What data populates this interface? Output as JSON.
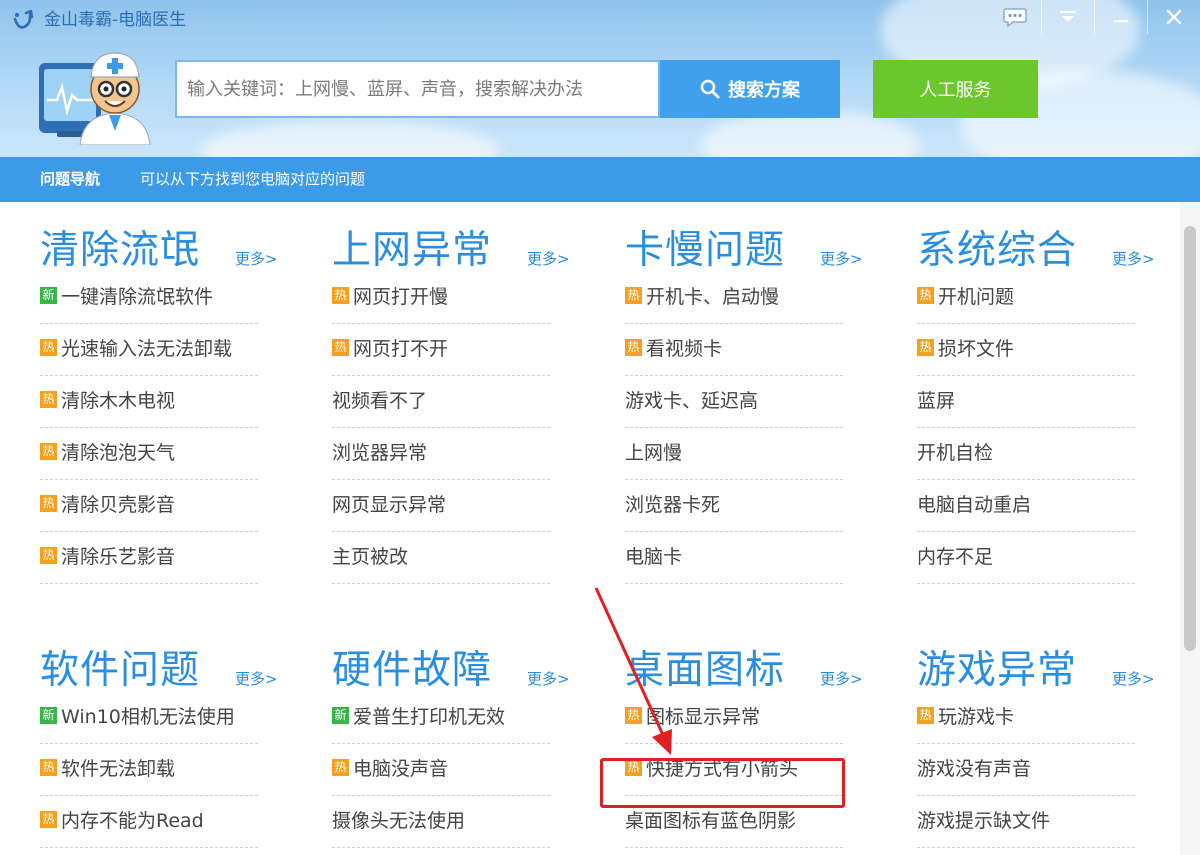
{
  "app": {
    "title": "金山毒霸-电脑医生"
  },
  "window": {
    "controls": [
      "chat-icon",
      "menu-icon",
      "minimize-icon",
      "close-icon"
    ]
  },
  "search": {
    "placeholder": "输入关键词：上网慢、蓝屏、声音，搜索解决办法",
    "button_label": "搜索方案"
  },
  "service": {
    "label": "人工服务"
  },
  "nav": {
    "title": "问题导航",
    "hint": "可以从下方找到您电脑对应的问题"
  },
  "badges": {
    "new": "新",
    "hot": "热"
  },
  "colors": {
    "accent_blue": "#2a8ee0",
    "nav_blue": "#3c9be8",
    "service_green": "#6cc72c",
    "hot_orange": "#f5a021",
    "new_green": "#3ab54a",
    "annotation_red": "#e02020"
  },
  "sections": [
    {
      "title": "清除流氓",
      "more": "更多>",
      "items": [
        {
          "badge": "new",
          "text": "一键清除流氓软件"
        },
        {
          "badge": "hot",
          "text": "光速输入法无法卸载"
        },
        {
          "badge": "hot",
          "text": "清除木木电视"
        },
        {
          "badge": "hot",
          "text": "清除泡泡天气"
        },
        {
          "badge": "hot",
          "text": "清除贝壳影音"
        },
        {
          "badge": "hot",
          "text": "清除乐艺影音"
        }
      ]
    },
    {
      "title": "上网异常",
      "more": "更多>",
      "items": [
        {
          "badge": "hot",
          "text": "网页打开慢"
        },
        {
          "badge": "hot",
          "text": "网页打不开"
        },
        {
          "badge": "",
          "text": "视频看不了"
        },
        {
          "badge": "",
          "text": "浏览器异常"
        },
        {
          "badge": "",
          "text": "网页显示异常"
        },
        {
          "badge": "",
          "text": "主页被改"
        }
      ]
    },
    {
      "title": "卡慢问题",
      "more": "更多>",
      "items": [
        {
          "badge": "hot",
          "text": "开机卡、启动慢"
        },
        {
          "badge": "hot",
          "text": "看视频卡"
        },
        {
          "badge": "",
          "text": "游戏卡、延迟高"
        },
        {
          "badge": "",
          "text": "上网慢"
        },
        {
          "badge": "",
          "text": "浏览器卡死"
        },
        {
          "badge": "",
          "text": "电脑卡"
        }
      ]
    },
    {
      "title": "系统综合",
      "more": "更多>",
      "items": [
        {
          "badge": "hot",
          "text": "开机问题"
        },
        {
          "badge": "hot",
          "text": "损坏文件"
        },
        {
          "badge": "",
          "text": "蓝屏"
        },
        {
          "badge": "",
          "text": "开机自检"
        },
        {
          "badge": "",
          "text": "电脑自动重启"
        },
        {
          "badge": "",
          "text": "内存不足"
        }
      ]
    },
    {
      "title": "软件问题",
      "more": "更多>",
      "items": [
        {
          "badge": "new",
          "text": "Win10相机无法使用"
        },
        {
          "badge": "hot",
          "text": "软件无法卸载"
        },
        {
          "badge": "hot",
          "text": "内存不能为Read"
        }
      ]
    },
    {
      "title": "硬件故障",
      "more": "更多>",
      "items": [
        {
          "badge": "new",
          "text": "爱普生打印机无效"
        },
        {
          "badge": "hot",
          "text": "电脑没声音"
        },
        {
          "badge": "",
          "text": "摄像头无法使用"
        }
      ]
    },
    {
      "title": "桌面图标",
      "more": "更多>",
      "items": [
        {
          "badge": "hot",
          "text": "图标显示异常"
        },
        {
          "badge": "hot",
          "text": "快捷方式有小箭头"
        },
        {
          "badge": "",
          "text": "桌面图标有蓝色阴影"
        }
      ]
    },
    {
      "title": "游戏异常",
      "more": "更多>",
      "items": [
        {
          "badge": "hot",
          "text": "玩游戏卡"
        },
        {
          "badge": "",
          "text": "游戏没有声音"
        },
        {
          "badge": "",
          "text": "游戏提示缺文件"
        }
      ]
    }
  ]
}
